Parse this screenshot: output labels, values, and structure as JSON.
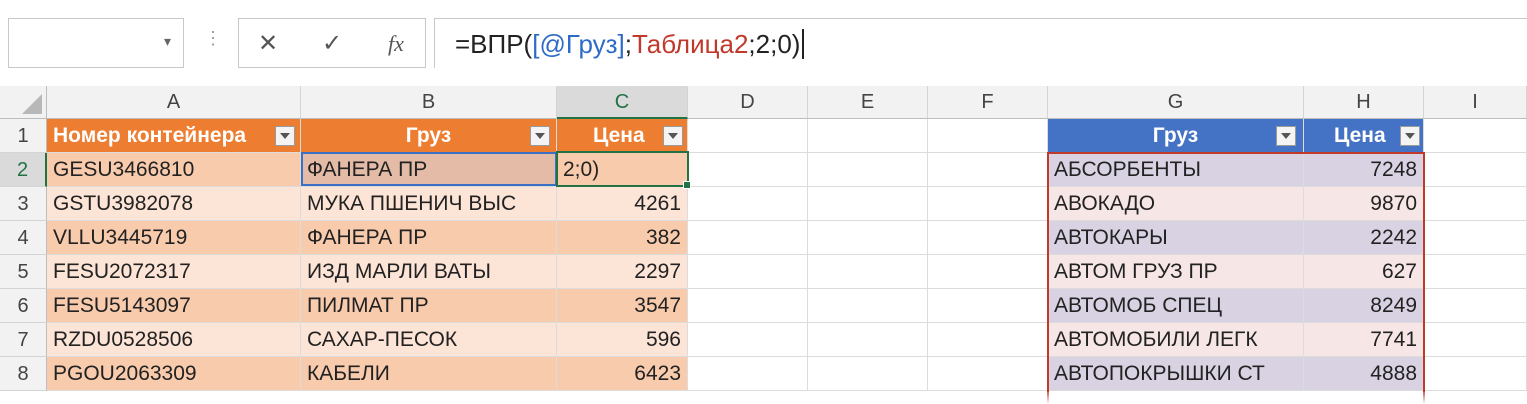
{
  "formula_bar": {
    "name_box": "",
    "cancel_icon": "✕",
    "enter_icon": "✓",
    "function_icon": "fx",
    "formula_prefix": "=ВПР(",
    "formula_ref": "[@Груз]",
    "formula_sep1": ";",
    "formula_table": "Таблица2",
    "formula_rest": ";2;0)"
  },
  "columns": [
    "A",
    "B",
    "C",
    "D",
    "E",
    "F",
    "G",
    "H",
    "I"
  ],
  "rows": [
    "1",
    "2",
    "3",
    "4",
    "5",
    "6",
    "7",
    "8"
  ],
  "table1": {
    "headers": [
      "Номер контейнера",
      "Груз",
      "Цена"
    ],
    "rows": [
      {
        "container": "GESU3466810",
        "cargo": "ФАНЕРА ПР",
        "price": "2;0)"
      },
      {
        "container": "GSTU3982078",
        "cargo": "МУКА ПШЕНИЧ ВЫС",
        "price": "4261"
      },
      {
        "container": "VLLU3445719",
        "cargo": "ФАНЕРА ПР",
        "price": "382"
      },
      {
        "container": "FESU2072317",
        "cargo": "ИЗД МАРЛИ ВАТЫ",
        "price": "2297"
      },
      {
        "container": "FESU5143097",
        "cargo": "ПИЛМАТ ПР",
        "price": "3547"
      },
      {
        "container": "RZDU0528506",
        "cargo": "САХАР-ПЕСОК",
        "price": "596"
      },
      {
        "container": "PGOU2063309",
        "cargo": "КАБЕЛИ",
        "price": "6423"
      }
    ]
  },
  "table2": {
    "headers": [
      "Груз",
      "Цена"
    ],
    "rows": [
      {
        "cargo": "АБСОРБЕНТЫ",
        "price": "7248"
      },
      {
        "cargo": "АВОКАДО",
        "price": "9870"
      },
      {
        "cargo": "АВТОКАРЫ",
        "price": "2242"
      },
      {
        "cargo": "АВТОМ ГРУЗ ПР",
        "price": "627"
      },
      {
        "cargo": "АВТОМОБ СПЕЦ",
        "price": "8249"
      },
      {
        "cargo": "АВТОМОБИЛИ ЛЕГК",
        "price": "7741"
      },
      {
        "cargo": "АВТОПОКРЫШКИ СТ",
        "price": "4888"
      }
    ]
  },
  "colors": {
    "table1_header": "#ed7d31",
    "table1_band_dark": "#f8cbad",
    "table1_band_light": "#fce4d6",
    "table2_header": "#4472c4",
    "table2_band_purple": "#d9d2e3",
    "table2_band_pink": "#f7e6e6",
    "active_cell_border": "#217346",
    "lookup_range_border": "#c0392b",
    "ref_cell_border": "#3a6fc4"
  }
}
